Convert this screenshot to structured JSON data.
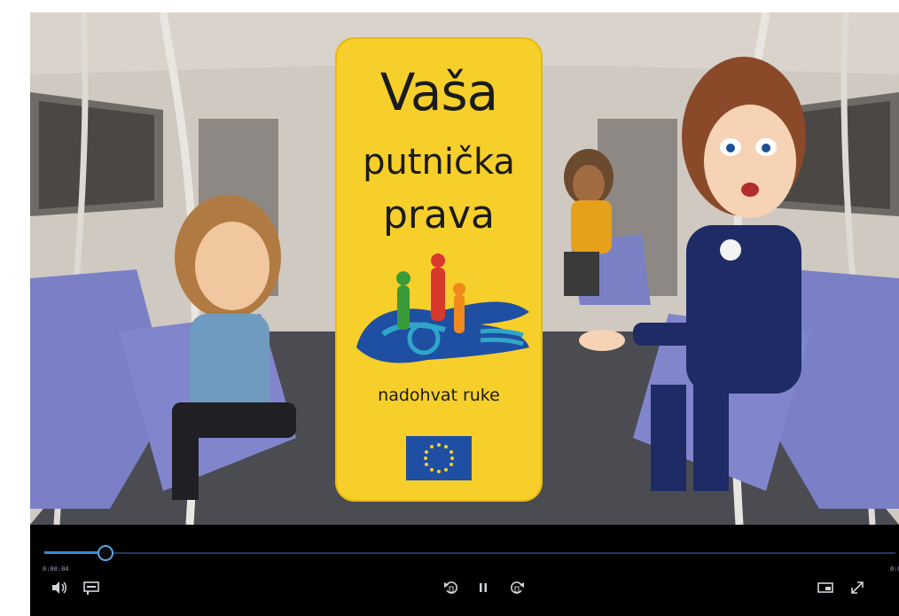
{
  "poster": {
    "title_line1": "Vaša",
    "title_line2": "putnička",
    "title_line3": "prava",
    "tagline": "nadohvat ruke"
  },
  "player": {
    "progress_fraction": 0.071,
    "time_elapsed": "0:00:04",
    "time_total": "0:0"
  },
  "icons": {
    "volume": "volume-icon",
    "subtitles": "subtitles-icon",
    "rewind": "rewind-icon",
    "pause": "pause-icon",
    "forward": "forward-icon",
    "miniplayer": "miniplayer-icon",
    "fullscreen": "fullscreen-icon"
  },
  "colors": {
    "poster_yellow": "#f6cf2a",
    "progress_blue": "#2f8bd8",
    "eu_blue": "#1f4fa3"
  }
}
